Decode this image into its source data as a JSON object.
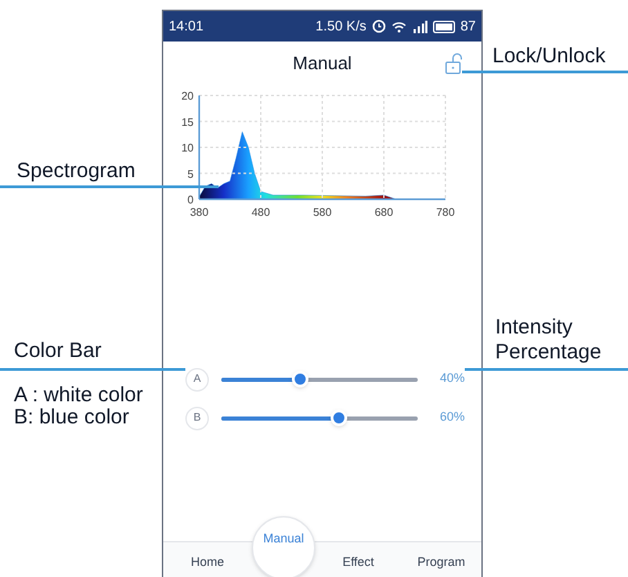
{
  "status_bar": {
    "time": "14:01",
    "speed": "1.50",
    "speed_unit": "K/s",
    "battery": "87"
  },
  "header": {
    "title": "Manual",
    "locked": false
  },
  "chart_data": {
    "type": "area",
    "x": [
      380,
      390,
      400,
      410,
      420,
      430,
      440,
      450,
      460,
      470,
      480,
      500,
      550,
      600,
      650,
      680,
      700,
      780
    ],
    "grid": true,
    "series": [
      {
        "color": "#1e88e5",
        "values": [
          0.5,
          2.5,
          3,
          2.2,
          3,
          3.5,
          8,
          13,
          10,
          5,
          1.5,
          0.8,
          0.8,
          0.7,
          0.6,
          0.8,
          0,
          0
        ]
      }
    ],
    "xlim": [
      380,
      780
    ],
    "ylim": [
      0,
      20
    ],
    "xticks": [
      380,
      480,
      580,
      680,
      780
    ],
    "yticks": [
      0,
      5,
      10,
      15,
      20
    ]
  },
  "channels": [
    {
      "name": "A",
      "level": 0.4,
      "reading": "40%"
    },
    {
      "name": "B",
      "level": 0.6,
      "reading": "60%"
    }
  ],
  "nav": [
    {
      "label": "Home",
      "selected": false
    },
    {
      "label": "Manual",
      "selected": true
    },
    {
      "label": "Effect",
      "selected": false
    },
    {
      "label": "Program",
      "selected": false
    }
  ],
  "annotations": {
    "lock": "Lock/Unlock",
    "spectrogram": "Spectrogram",
    "color_bar": "Color Bar",
    "legend_a": "A : white color",
    "legend_b": "B: blue color",
    "intensity": [
      "Intensity",
      "Percentage"
    ]
  }
}
